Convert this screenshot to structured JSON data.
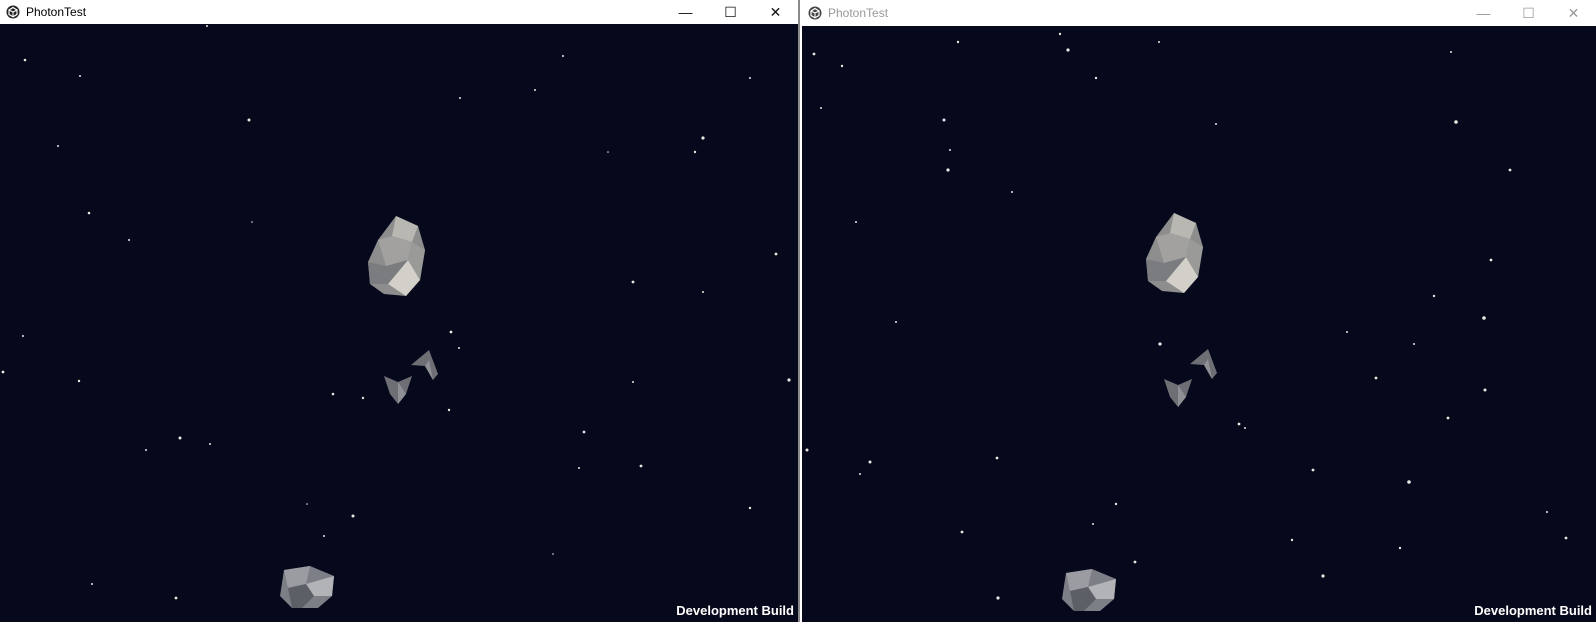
{
  "windows": [
    {
      "title": "PhotonTest",
      "active": true,
      "controls": {
        "minimize": "—",
        "maximize": "☐",
        "close": "✕"
      },
      "overlay_label": "Development Build"
    },
    {
      "title": "PhotonTest",
      "active": false,
      "controls": {
        "minimize": "—",
        "maximize": "☐",
        "close": "✕"
      },
      "overlay_label": "Development Build"
    }
  ],
  "colors": {
    "space_background": "#06081c",
    "titlebar_active_text": "#000000",
    "titlebar_inactive_text": "#9a9a9a",
    "asteroid_light": "#c9c7c0",
    "asteroid_mid": "#8d8d8d",
    "asteroid_dark": "#5d5f66",
    "ship": "#6e6f75",
    "star": "#e8e8e0"
  },
  "icons": {
    "app": "unity-logo-icon"
  }
}
